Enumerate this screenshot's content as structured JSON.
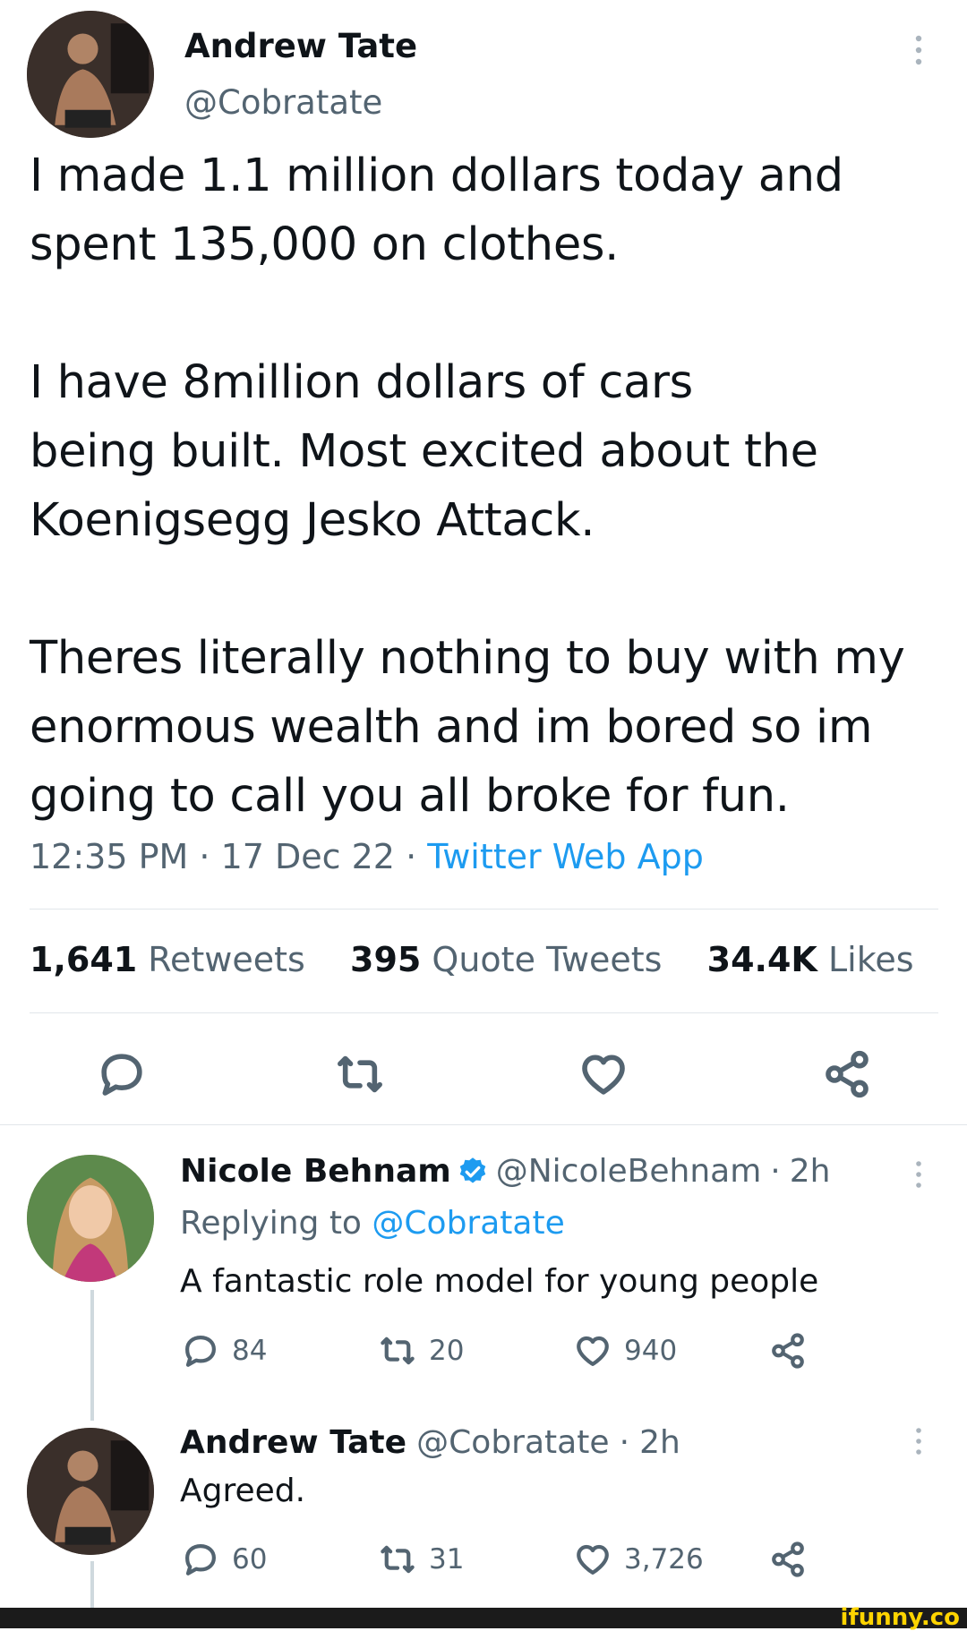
{
  "tweet": {
    "author_name": "Andrew Tate",
    "author_handle": "@Cobratate",
    "text": "I made 1.1 million dollars today and\nspent 135,000 on clothes.\n\nI have 8million dollars of cars\nbeing built. Most excited about the\nKoenigsegg Jesko Attack.\n\nTheres literally nothing to buy with my\nenormous wealth and im bored so im\ngoing to call you all broke for fun.",
    "time": "12:35 PM",
    "date": "17 Dec 22",
    "separator": "·",
    "source": "Twitter Web App",
    "stats": {
      "retweets_count": "1,641",
      "retweets_label": "Retweets",
      "quotes_count": "395",
      "quotes_label": "Quote Tweets",
      "likes_count": "34.4K",
      "likes_label": "Likes"
    },
    "actions": [
      "reply-icon",
      "retweet-icon",
      "heart-icon",
      "share-icon"
    ]
  },
  "replies": [
    {
      "name": "Nicole Behnam",
      "verified": true,
      "handle": "@NicoleBehnam",
      "time": "2h",
      "replying_label": "Replying to",
      "replying_handle": "@Cobratate",
      "text": "A fantastic role model for young people",
      "replies": "84",
      "retweets": "20",
      "likes": "940"
    },
    {
      "name": "Andrew Tate",
      "verified": false,
      "handle": "@Cobratate",
      "time": "2h",
      "text": "Agreed.",
      "replies": "60",
      "retweets": "31",
      "likes": "3,726"
    }
  ],
  "watermark": "ifunny.co",
  "colors": {
    "link": "#1d9bf0",
    "verified": "#1d9bf0",
    "secondary_text": "#536471",
    "watermark_bg": "#1b1b1b",
    "watermark_text": "#ffd400"
  }
}
